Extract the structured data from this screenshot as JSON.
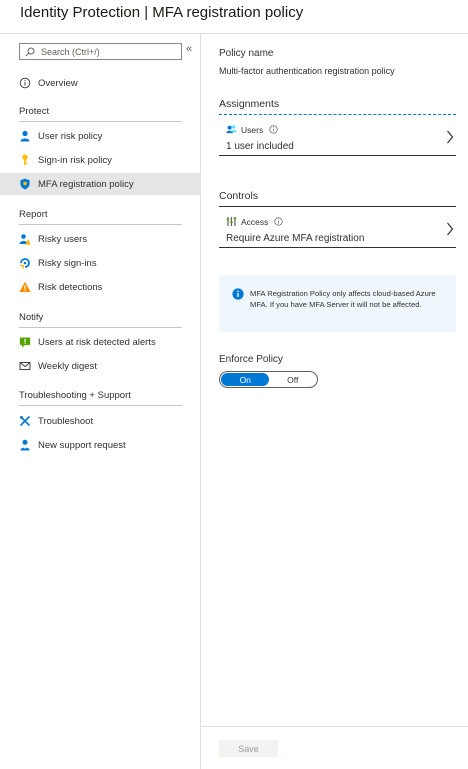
{
  "header": {
    "title": "Identity Protection | MFA registration policy"
  },
  "sidebar": {
    "search_placeholder": "Search (Ctrl+/)",
    "collapse_glyph": "«",
    "overview": {
      "label": "Overview",
      "icon": "info-circle-icon"
    },
    "sections": [
      {
        "title": "Protect",
        "items": [
          {
            "label": "User risk policy",
            "icon": "user-icon",
            "selected": false
          },
          {
            "label": "Sign-in risk policy",
            "icon": "key-icon",
            "selected": false
          },
          {
            "label": "MFA registration policy",
            "icon": "shield-icon",
            "selected": true
          }
        ]
      },
      {
        "title": "Report",
        "items": [
          {
            "label": "Risky users",
            "icon": "users-warning-icon"
          },
          {
            "label": "Risky sign-ins",
            "icon": "signin-icon"
          },
          {
            "label": "Risk detections",
            "icon": "warning-triangle-icon"
          }
        ]
      },
      {
        "title": "Notify",
        "items": [
          {
            "label": "Users at risk detected alerts",
            "icon": "alert-message-icon"
          },
          {
            "label": "Weekly digest",
            "icon": "envelope-icon"
          }
        ]
      },
      {
        "title": "Troubleshooting + Support",
        "items": [
          {
            "label": "Troubleshoot",
            "icon": "wrench-icon"
          },
          {
            "label": "New support request",
            "icon": "support-person-icon"
          }
        ]
      }
    ]
  },
  "main": {
    "policy_name_label": "Policy name",
    "policy_name_value": "Multi-factor authentication registration policy",
    "assignments": {
      "title": "Assignments",
      "users_label": "Users",
      "users_value": "1 user included"
    },
    "controls": {
      "title": "Controls",
      "access_label": "Access",
      "access_value": "Require Azure MFA registration"
    },
    "info_text": "MFA Registration Policy only affects cloud-based Azure MFA. If you have MFA Server it will not be affected.",
    "enforce": {
      "label": "Enforce Policy",
      "on_label": "On",
      "off_label": "Off",
      "selected": "On"
    },
    "save_label": "Save"
  },
  "colors": {
    "accent": "#0078d4",
    "selected_bg": "#e5e5e5",
    "info_bg": "#eff6fc"
  }
}
